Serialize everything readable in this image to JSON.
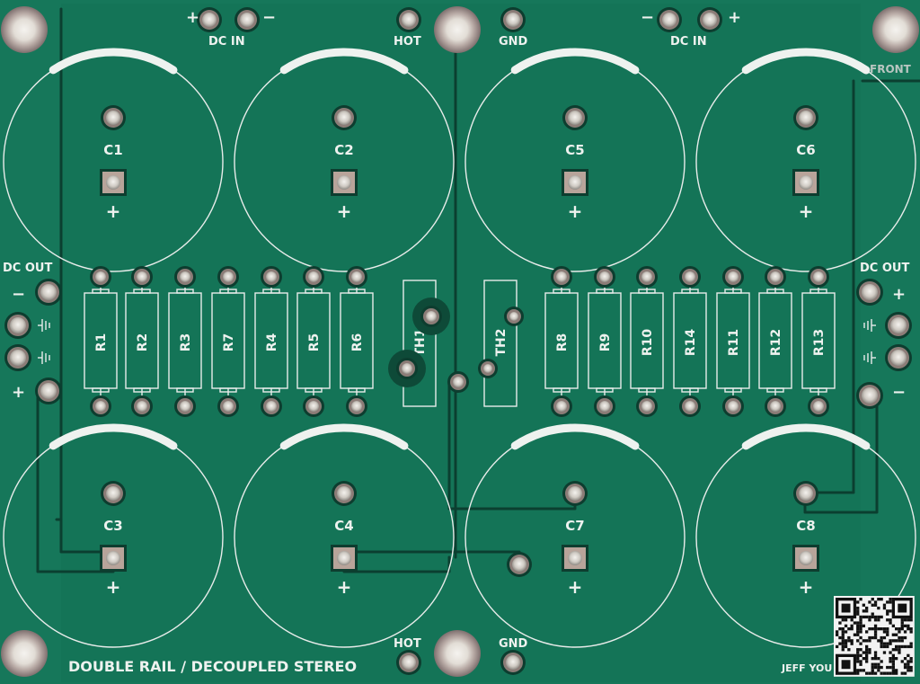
{
  "board": {
    "substrate_color": "#16775a",
    "silkscreen_color": "#eef2ef",
    "pad_color": "#d9d5cf",
    "title": "DOUBLE RAIL / DECOUPLED STEREO",
    "author": "JEFF YOU",
    "front_label": "FRONT",
    "dc_in_label": "DC IN",
    "dc_out_label": "DC OUT",
    "hot_label": "HOT",
    "gnd_label": "GND",
    "plus": "+",
    "minus": "−",
    "capacitors": [
      "C1",
      "C2",
      "C5",
      "C6",
      "C3",
      "C4",
      "C7",
      "C8"
    ],
    "resistors_left": [
      "R1",
      "R2",
      "R3",
      "R7",
      "R4",
      "R5",
      "R6"
    ],
    "resistors_right": [
      "R8",
      "R9",
      "R10",
      "R14",
      "R11",
      "R12",
      "R13"
    ],
    "thermistors": [
      "TH1",
      "TH2"
    ]
  }
}
